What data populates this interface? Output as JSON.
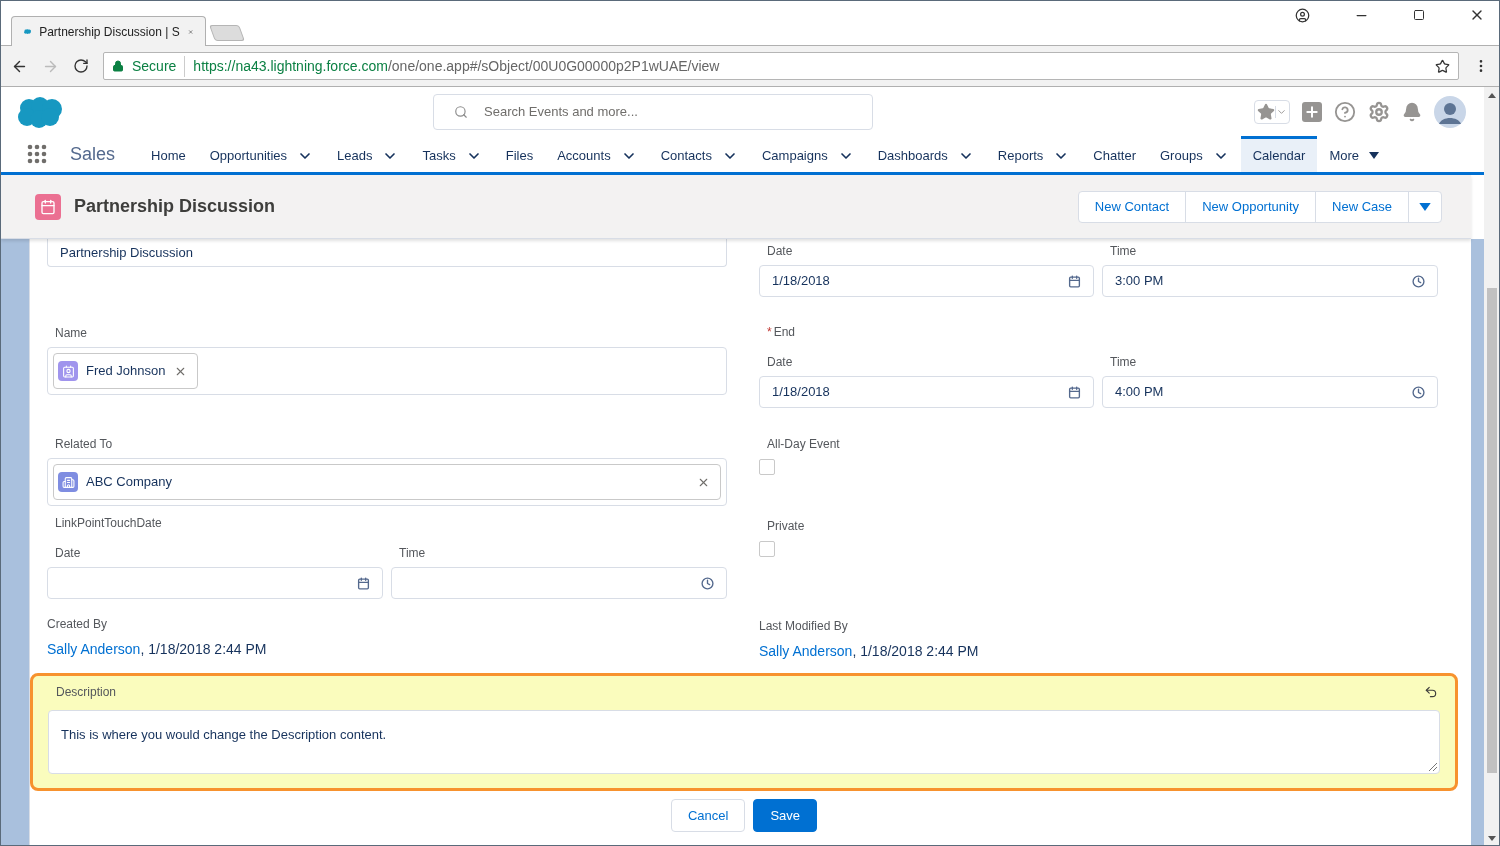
{
  "browser": {
    "tab_title": "Partnership Discussion | S",
    "secure_label": "Secure",
    "url_host": "https://na43.lightning.force.com",
    "url_path": "/one/one.app#/sObject/00U0G00000p2P1wUAE/view"
  },
  "header": {
    "search": {
      "placeholder": "Search Events and more..."
    }
  },
  "nav": {
    "app_name": "Sales",
    "items": [
      {
        "label": "Home",
        "kind": "link",
        "selected": false
      },
      {
        "label": "Opportunities",
        "kind": "menu",
        "selected": false
      },
      {
        "label": "Leads",
        "kind": "menu",
        "selected": false
      },
      {
        "label": "Tasks",
        "kind": "menu",
        "selected": false
      },
      {
        "label": "Files",
        "kind": "link",
        "selected": false
      },
      {
        "label": "Accounts",
        "kind": "menu",
        "selected": false
      },
      {
        "label": "Contacts",
        "kind": "menu",
        "selected": false
      },
      {
        "label": "Campaigns",
        "kind": "menu",
        "selected": false
      },
      {
        "label": "Dashboards",
        "kind": "menu",
        "selected": false
      },
      {
        "label": "Reports",
        "kind": "menu",
        "selected": false
      },
      {
        "label": "Chatter",
        "kind": "link",
        "selected": false
      },
      {
        "label": "Groups",
        "kind": "menu",
        "selected": false
      },
      {
        "label": "Calendar",
        "kind": "link",
        "selected": true
      },
      {
        "label": "More",
        "kind": "overflow",
        "selected": false
      }
    ]
  },
  "record": {
    "title": "Partnership Discussion",
    "actions": [
      "New Contact",
      "New Opportunity",
      "New Case"
    ]
  },
  "form": {
    "subject": {
      "value": "Partnership Discussion"
    },
    "name": {
      "label": "Name",
      "pill": "Fred Johnson"
    },
    "related_to": {
      "label": "Related To",
      "pill": "ABC Company"
    },
    "link_point": {
      "label": "LinkPointTouchDate",
      "date_label": "Date",
      "time_label": "Time"
    },
    "start": {
      "date_label": "Date",
      "date": "1/18/2018",
      "time_label": "Time",
      "time": "3:00 PM"
    },
    "end": {
      "label": "End",
      "required_mark": "*",
      "date_label": "Date",
      "date": "1/18/2018",
      "time_label": "Time",
      "time": "4:00 PM"
    },
    "checkboxes": [
      {
        "label": "All-Day Event",
        "checked": false
      },
      {
        "label": "Private",
        "checked": false
      }
    ],
    "created_by": {
      "label": "Created By",
      "user": "Sally Anderson",
      "suffix": ", 1/18/2018 2:44 PM"
    },
    "last_modified_by": {
      "label": "Last Modified By",
      "user": "Sally Anderson",
      "suffix": ", 1/18/2018 2:44 PM"
    },
    "description": {
      "label": "Description",
      "value": "This is where you would change the Description content.",
      "changed": true
    },
    "buttons": [
      {
        "label": "Cancel",
        "kind": "neutral"
      },
      {
        "label": "Save",
        "kind": "brand"
      }
    ]
  }
}
